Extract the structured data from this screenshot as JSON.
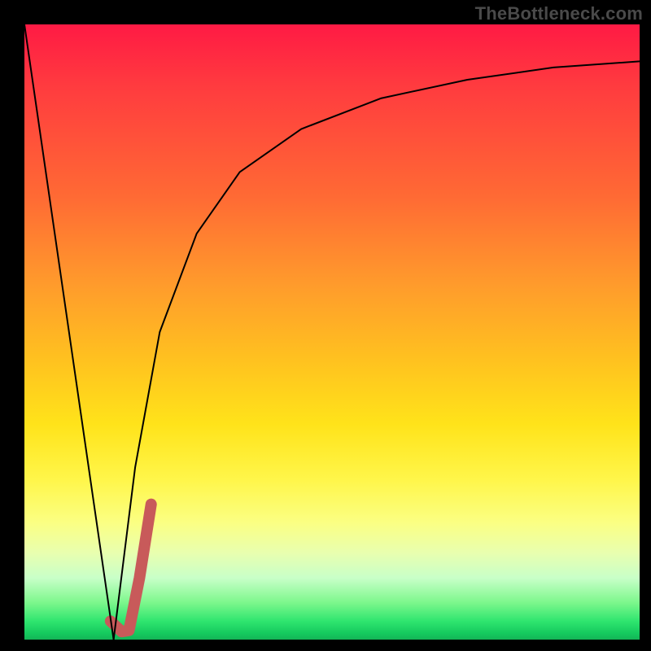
{
  "watermark": "TheBottleneck.com",
  "chart_data": {
    "type": "line",
    "title": "",
    "xlabel": "",
    "ylabel": "",
    "xlim": [
      0,
      100
    ],
    "ylim": [
      0,
      100
    ],
    "grid": false,
    "legend": false,
    "series": [
      {
        "name": "left-descending-line",
        "x": [
          0,
          14.5
        ],
        "y": [
          100,
          0
        ],
        "color": "#000000",
        "stroke_width": 2
      },
      {
        "name": "right-ascending-curve",
        "x": [
          14.5,
          18,
          22,
          28,
          35,
          45,
          58,
          72,
          86,
          100
        ],
        "y": [
          0,
          28,
          50,
          66,
          76,
          83,
          88,
          91,
          93,
          94
        ],
        "color": "#000000",
        "stroke_width": 2
      },
      {
        "name": "highlight-hook",
        "x": [
          14.0,
          15.8,
          17.0,
          18.7,
          20.6
        ],
        "y": [
          3.0,
          1.3,
          1.5,
          10.0,
          22.0
        ],
        "color": "#c85a5a",
        "stroke_width": 14
      }
    ],
    "background_gradient_stops": [
      {
        "pos": 0,
        "color": "#ff1a44"
      },
      {
        "pos": 10,
        "color": "#ff3b3f"
      },
      {
        "pos": 28,
        "color": "#ff6a34"
      },
      {
        "pos": 42,
        "color": "#ff9a2c"
      },
      {
        "pos": 55,
        "color": "#ffc31f"
      },
      {
        "pos": 65,
        "color": "#ffe31a"
      },
      {
        "pos": 74,
        "color": "#fff64a"
      },
      {
        "pos": 81,
        "color": "#fbff83"
      },
      {
        "pos": 86,
        "color": "#e8ffb0"
      },
      {
        "pos": 90,
        "color": "#c8ffc8"
      },
      {
        "pos": 94,
        "color": "#7cf78c"
      },
      {
        "pos": 97,
        "color": "#2fe56f"
      },
      {
        "pos": 99,
        "color": "#15c95e"
      },
      {
        "pos": 100,
        "color": "#14b457"
      }
    ]
  }
}
